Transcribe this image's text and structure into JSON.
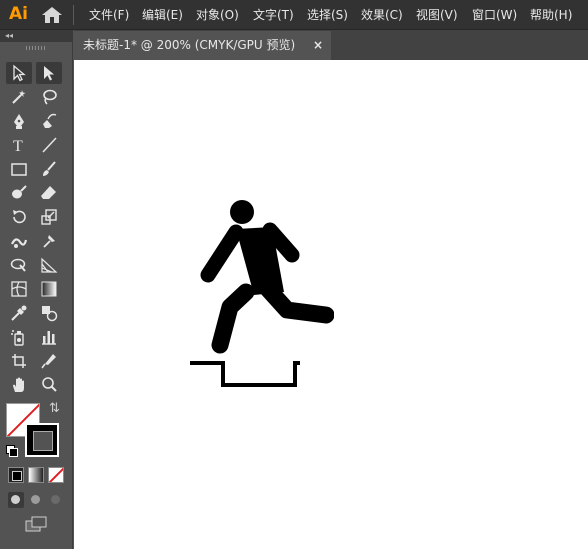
{
  "app": {
    "logo_text": "Ai",
    "accent_color": "#ff9a00"
  },
  "menu": {
    "items": [
      {
        "label": "文件(F)"
      },
      {
        "label": "编辑(E)"
      },
      {
        "label": "对象(O)"
      },
      {
        "label": "文字(T)"
      },
      {
        "label": "选择(S)"
      },
      {
        "label": "效果(C)"
      },
      {
        "label": "视图(V)"
      },
      {
        "label": "窗口(W)"
      },
      {
        "label": "帮助(H)"
      }
    ]
  },
  "toolbar": {
    "collapse_glyph": "◂◂",
    "tools": [
      {
        "icon": "selection-tool-icon"
      },
      {
        "icon": "direct-selection-tool-icon"
      },
      {
        "icon": "magic-wand-tool-icon"
      },
      {
        "icon": "lasso-tool-icon"
      },
      {
        "icon": "pen-tool-icon"
      },
      {
        "icon": "curvature-tool-icon"
      },
      {
        "icon": "type-tool-icon",
        "glyph": "T"
      },
      {
        "icon": "line-segment-tool-icon"
      },
      {
        "icon": "rectangle-tool-icon"
      },
      {
        "icon": "paintbrush-tool-icon"
      },
      {
        "icon": "shaper-tool-icon"
      },
      {
        "icon": "eraser-tool-icon"
      },
      {
        "icon": "rotate-tool-icon"
      },
      {
        "icon": "scale-tool-icon"
      },
      {
        "icon": "width-tool-icon"
      },
      {
        "icon": "puppet-warp-tool-icon"
      },
      {
        "icon": "shape-builder-tool-icon"
      },
      {
        "icon": "perspective-grid-tool-icon"
      },
      {
        "icon": "mesh-tool-icon"
      },
      {
        "icon": "gradient-tool-icon"
      },
      {
        "icon": "eyedropper-tool-icon"
      },
      {
        "icon": "blend-tool-icon"
      },
      {
        "icon": "symbol-sprayer-tool-icon"
      },
      {
        "icon": "column-graph-tool-icon"
      },
      {
        "icon": "artboard-tool-icon"
      },
      {
        "icon": "slice-tool-icon"
      },
      {
        "icon": "hand-tool-icon"
      },
      {
        "icon": "zoom-tool-icon"
      }
    ],
    "swap_glyph": "⇅",
    "fill_color": "#ffffff",
    "stroke_color": "#000000",
    "none_color": "#e02020"
  },
  "document": {
    "tab_title": "未标题-1* @ 200% (CMYK/GPU 预览)",
    "close_glyph": "×"
  },
  "canvas": {
    "background": "#ffffff",
    "artwork": "running-figure-icon"
  }
}
